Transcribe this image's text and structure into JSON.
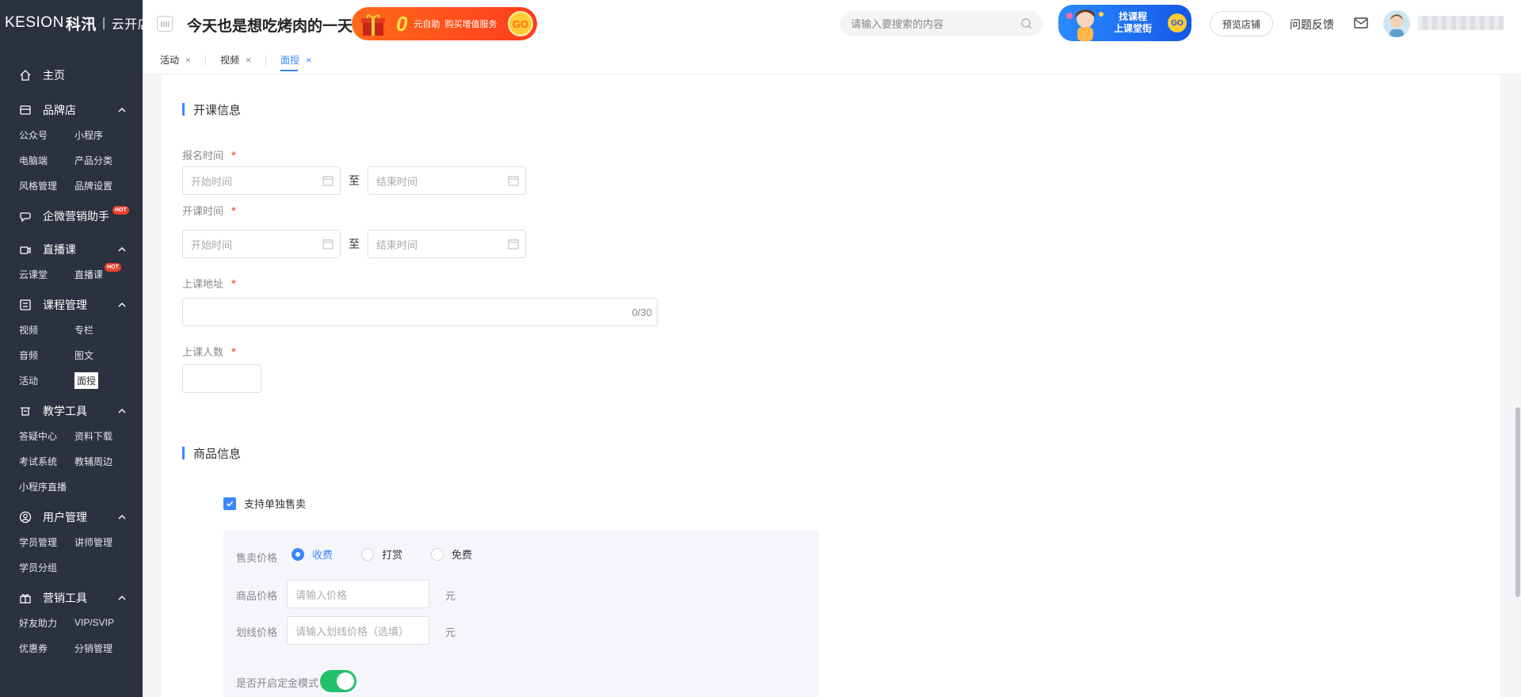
{
  "sidebar": {
    "logo_en": "KESION",
    "logo_cn": "科汛",
    "logo_shop": "云开店",
    "home": "主页",
    "groups": [
      {
        "label": "品牌店",
        "items": [
          "公众号",
          "小程序",
          "电脑端",
          "产品分类",
          "风格管理",
          "品牌设置"
        ]
      },
      {
        "label": "直播课",
        "items": [
          "云课堂",
          "直播课"
        ]
      },
      {
        "label": "课程管理",
        "items": [
          "视频",
          "专栏",
          "音频",
          "图文",
          "活动",
          "面授"
        ]
      },
      {
        "label": "教学工具",
        "items": [
          "答疑中心",
          "资料下载",
          "考试系统",
          "教辅周边",
          "小程序直播"
        ]
      },
      {
        "label": "用户管理",
        "items": [
          "学员管理",
          "讲师管理",
          "学员分组"
        ]
      },
      {
        "label": "营销工具",
        "items": [
          "好友助力",
          "VIP/SVIP",
          "优惠券",
          "分销管理"
        ]
      }
    ],
    "wecom": "企微营销助手",
    "hot": "HOT"
  },
  "header": {
    "slogan": "今天也是想吃烤肉的一天",
    "promo_zero": "0",
    "promo_text1": "元自助",
    "promo_text2": "购买增值服务",
    "promo_go": "GO",
    "search_placeholder": "请输入要搜索的内容",
    "course_line1": "找课程",
    "course_line2": "上课堂街",
    "course_go": "GO",
    "preview_label": "预览店铺",
    "feedback_label": "问题反馈"
  },
  "tabs": [
    {
      "label": "活动"
    },
    {
      "label": "视频"
    },
    {
      "label": "面授"
    }
  ],
  "tab_close": "×",
  "form": {
    "section1": "开课信息",
    "signup_label": "报名时间",
    "class_label": "开课时间",
    "address_label": "上课地址",
    "people_label": "上课人数",
    "required": "*",
    "start_placeholder": "开始时间",
    "end_placeholder": "结束时间",
    "to": "至",
    "address_counter": "0/30",
    "section2": "商品信息",
    "sell_alone": "支持单独售卖",
    "price_type_label": "售卖价格",
    "price_types": [
      "收费",
      "打赏",
      "免费"
    ],
    "goods_price_label": "商品价格",
    "goods_price_placeholder": "请输入价格",
    "strike_price_label": "划线价格",
    "strike_price_placeholder": "请输入划线价格（选填）",
    "unit": "元",
    "deposit_label": "是否开启定金模式"
  },
  "colors": {
    "sidebar_bg": "#2b313f",
    "accent": "#3a86ff",
    "switch_on": "#22c06b",
    "required": "#e8412b"
  }
}
